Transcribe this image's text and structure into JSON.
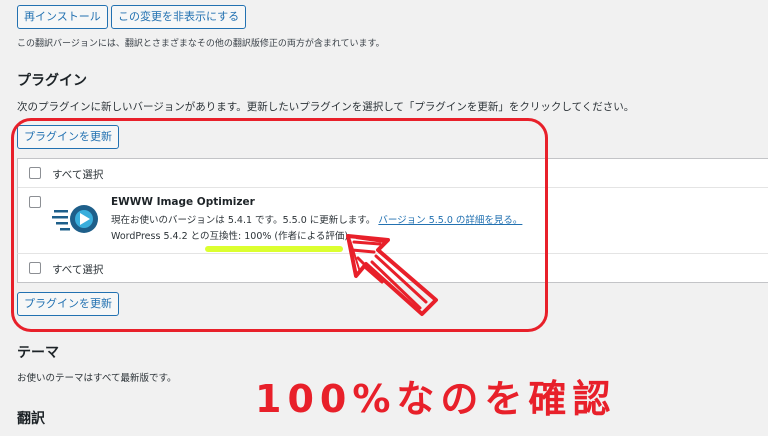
{
  "top_buttons": {
    "reinstall": "再インストール",
    "hide": "この変更を非表示にする"
  },
  "translation_note": "この翻訳バージョンには、翻訳とさまざまなその他の翻訳版修正の両方が含まれています。",
  "plugins_section": {
    "title": "プラグイン",
    "description": "次のプラグインに新しいバージョンがあります。更新したいプラグインを選択して「プラグインを更新」をクリックしてください。",
    "update_button": "プラグインを更新",
    "select_all": "すべて選択",
    "plugin": {
      "name": "EWWW Image Optimizer",
      "status_text": "現在お使いのバージョンは 5.4.1 です。5.5.0 に更新します。",
      "details_link": "バージョン 5.5.0 の詳細を見る。",
      "compat_text": "WordPress 5.4.2 との互換性: 100% (作者による評価)"
    }
  },
  "themes_section": {
    "title": "テーマ",
    "description": "お使いのテーマはすべて最新版です。"
  },
  "translations_section": {
    "title": "翻訳"
  },
  "annotation": {
    "caption": "100%なのを確認",
    "color": "#e8202a",
    "highlight_color": "#d8ff1a"
  }
}
